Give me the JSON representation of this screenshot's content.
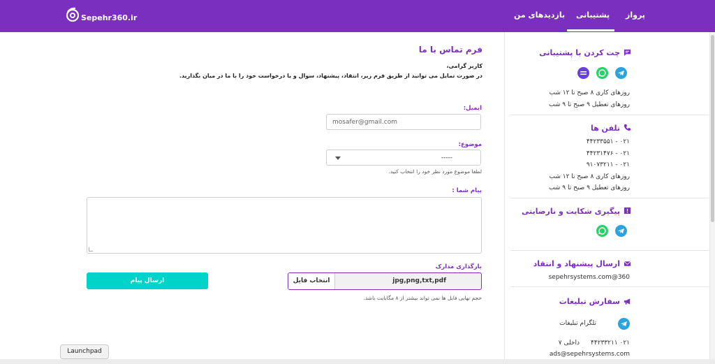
{
  "header": {
    "logo_text": "Sepehr360.ir",
    "nav": [
      {
        "label": "پرواز"
      },
      {
        "label": "پشتیبانی"
      },
      {
        "label": "بازدیدهای من"
      }
    ]
  },
  "form": {
    "title": "فرم تماس با ما",
    "greeting": "کاربر گرامی،",
    "description": "در صورت تمایل می توانید از طریق فرم زیر، انتقاد، پیشنهاد، سوال و یا درخواست خود را با ما در میان بگذارید.",
    "email_label": "ایمیل:",
    "email_value": "mosafer@gmail.com",
    "subject_label": "موضوع:",
    "subject_value": "-----",
    "subject_hint": "لطفا موضوع مورد نظر خود را انتخاب کنید.",
    "message_label": "پیام شما :",
    "upload_label": "بارگذاری مدارک",
    "file_button": "انتخاب فایل",
    "file_types": "jpg,png,txt,pdf",
    "file_hint": "حجم نهایی فایل ها نمی تواند بیشتر از ۸ مگابایت باشد.",
    "send_button": "ارسال پیام"
  },
  "sidebar": {
    "chat_title": "چت کردن با پشتیبانی",
    "chat_hours_work": "روزهای کاری ۸ صبح تا ۱۲ شب",
    "chat_hours_holiday": "روزهای تعطیل ۹ صبح تا ۹ شب",
    "phones_title": "تلفن ها",
    "phones": [
      "۰۲۱ - ۴۴۲۳۳۵۵۱",
      "۰۲۱ - ۴۴۲۳۱۴۷۶",
      "۰۲۱ - ۹۱۰۷۳۲۱۱"
    ],
    "phone_hours_work": "روزهای کاری ۸ صبح تا ۱۲ شب",
    "phone_hours_holiday": "روزهای تعطیل ۹ صبح تا ۹ شب",
    "complaint_title": "پیگیری شکایت و نارضایتی",
    "suggest_title": "ارسال پیشنهاد و انتقاد",
    "suggest_email": "360@sepehrsystems.com",
    "ads_title": "سفارش تبلیغات",
    "ads_telegram": "تلگرام تبلیغات",
    "ads_phone": "۰۲۱ ۴۴۲۳۳۲۱۱",
    "ads_ext": "داخلی ۷",
    "ads_email": "ads@sepehrsystems.com"
  },
  "launchpad": "Launchpad",
  "colors": {
    "brand": "#7b2fbf",
    "accent": "#00d4c8",
    "telegram": "#2aa3df",
    "whatsapp": "#25d366"
  }
}
